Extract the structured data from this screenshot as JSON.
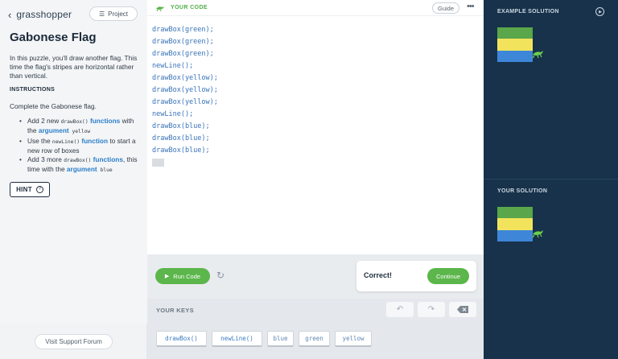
{
  "left": {
    "brand": "grasshopper",
    "project_label": "Project",
    "title": "Gabonese Flag",
    "intro": "In this puzzle, you'll draw another flag. This time the flag's stripes are horizontal rather than vertical.",
    "instructions_heading": "INSTRUCTIONS",
    "task": "Complete the Gabonese flag.",
    "bullets": [
      {
        "a": "Add 2 new ",
        "code1": "drawBox()",
        "kw1": " functions",
        "b": " with the ",
        "kw2": "argument",
        "code2": " yellow"
      },
      {
        "a": "Use the ",
        "code1": "newLine()",
        "kw1": " function",
        "b": " to start a new row of boxes"
      },
      {
        "a": "Add 3 more ",
        "code1": "drawBox()",
        "kw1": " functions",
        "b": ", this time with the ",
        "kw2": "argument",
        "code2": " blue"
      }
    ],
    "hint_label": "HINT",
    "support_label": "Visit Support Forum"
  },
  "editor": {
    "header_label": "YOUR CODE",
    "guide_label": "Guide",
    "more_label": "•••",
    "lines": [
      "drawBox(green);",
      "drawBox(green);",
      "drawBox(green);",
      "newLine();",
      "drawBox(yellow);",
      "drawBox(yellow);",
      "drawBox(yellow);",
      "newLine();",
      "drawBox(blue);",
      "drawBox(blue);",
      "drawBox(blue);"
    ],
    "run_label": "Run Code",
    "result_text": "Correct!",
    "continue_label": "Continue",
    "keys_label": "YOUR KEYS",
    "keys": [
      "drawBox()",
      "newLine()",
      "blue",
      "green",
      "yellow"
    ]
  },
  "right": {
    "example_label": "EXAMPLE SOLUTION",
    "your_label": "YOUR SOLUTION",
    "flag_colors": [
      "#5aa64a",
      "#f2e35c",
      "#3e86d8"
    ]
  },
  "colors": {
    "accent_green": "#5cb64b",
    "code_blue": "#3973b8",
    "panel_dark": "#17324a"
  }
}
